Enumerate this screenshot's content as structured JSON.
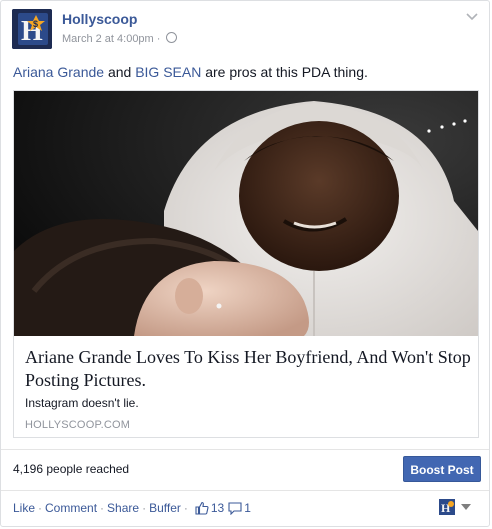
{
  "post": {
    "author": "Hollyscoop",
    "timestamp": "March 2 at 4:00pm",
    "dot": "·",
    "message": {
      "mention_1": "Ariana Grande",
      "text_1": " and ",
      "mention_2": "BIG SEAN",
      "text_2": " are pros at this PDA thing."
    }
  },
  "link_preview": {
    "title": "Ariane Grande Loves To Kiss Her Boyfriend, And Won't Stop Posting Pictures.",
    "description": "Instagram doesn't lie.",
    "domain": "HOLLYSCOOP.COM"
  },
  "reach": {
    "text": "4,196 people reached",
    "boost_label": "Boost Post"
  },
  "actions": {
    "like": "Like",
    "comment": "Comment",
    "share": "Share",
    "buffer": "Buffer",
    "separator": "·",
    "like_count": "13",
    "comment_count": "1"
  },
  "colors": {
    "link": "#3b5998",
    "boost": "#4267b2",
    "muted": "#90949c"
  },
  "icons": {
    "avatar": "hollyscoop-logo",
    "privacy": "globe-icon",
    "menu": "chevron-down-icon",
    "likes": "thumbs-up-icon",
    "comments": "comment-bubble-icon"
  }
}
